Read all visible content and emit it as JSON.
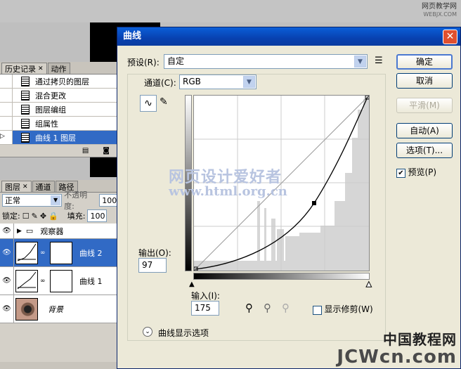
{
  "watermark_top": {
    "line1": "网页教学网",
    "line2": "WEBJX.COM"
  },
  "history": {
    "tabs": [
      {
        "label": "历史记录"
      },
      {
        "label": "动作"
      }
    ],
    "items": [
      {
        "label": "通过拷贝的图层"
      },
      {
        "label": "混合更改"
      },
      {
        "label": "图层编组"
      },
      {
        "label": "组属性"
      },
      {
        "label": "曲线 1 图层"
      }
    ]
  },
  "layers": {
    "tabs": [
      {
        "label": "图层"
      },
      {
        "label": "通道"
      },
      {
        "label": "路径"
      }
    ],
    "blend_mode": "正常",
    "opacity_label": "不透明度:",
    "opacity_value": "100",
    "lock_label": "锁定:",
    "fill_label": "填充:",
    "fill_value": "100",
    "items": [
      {
        "name": "观察器"
      },
      {
        "name": "曲线 2"
      },
      {
        "name": "曲线 1"
      },
      {
        "name": "背景"
      }
    ]
  },
  "dialog": {
    "title": "曲线",
    "close": "✕",
    "preset_label": "预设(R):",
    "preset_value": "自定",
    "channel_label": "通道(C):",
    "channel_value": "RGB",
    "output_label": "输出(O):",
    "output_value": "97",
    "input_label": "输入(I):",
    "input_value": "175",
    "show_clipping": "显示修剪(W)",
    "curve_options": "曲线显示选项",
    "buttons": {
      "ok": "确定",
      "cancel": "取消",
      "smooth": "平滑(M)",
      "auto": "自动(A)",
      "options": "选项(T)..."
    },
    "preview_label": "预览(P)",
    "preview_checked": true
  },
  "watermark_center": {
    "cn": "网页设计爱好者",
    "url": "www.html.org.cn"
  },
  "watermark_bottom": {
    "cn": "中国教程网",
    "en": "JCWcn.com"
  }
}
